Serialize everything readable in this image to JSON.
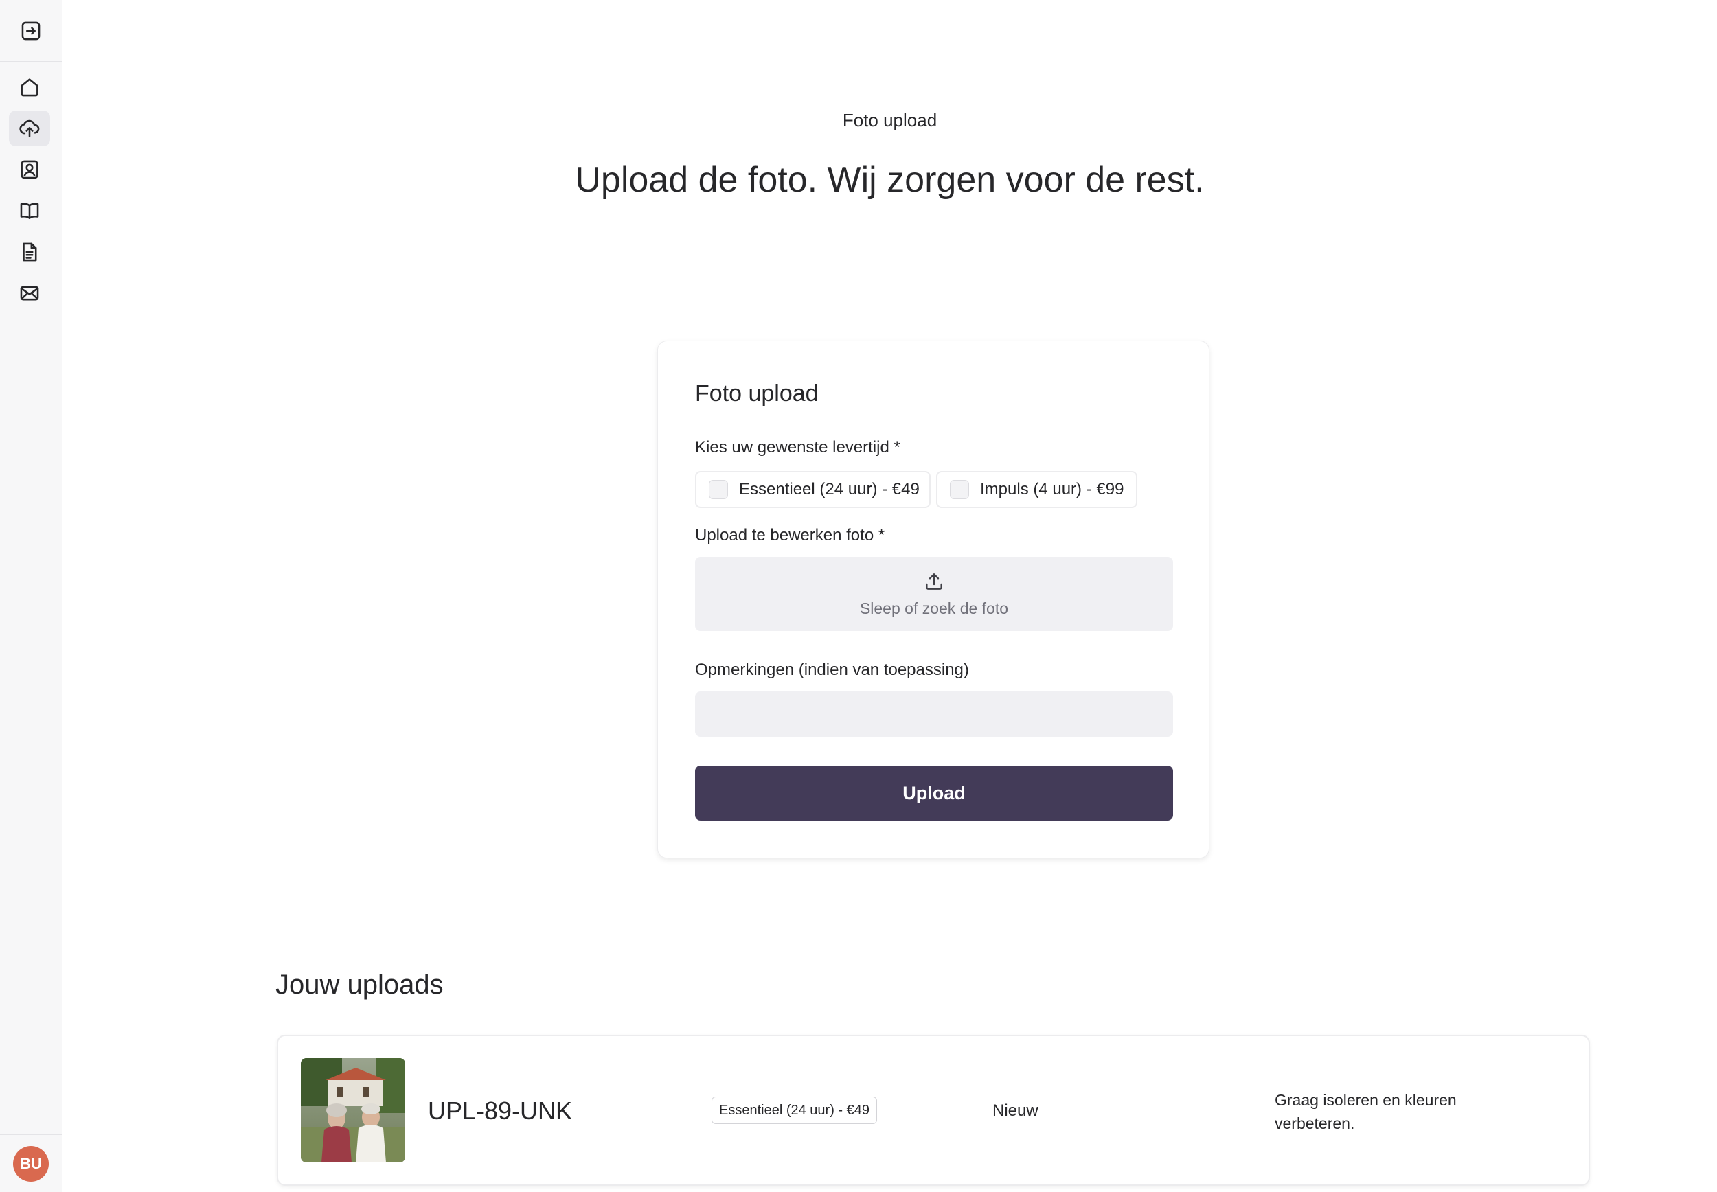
{
  "sidebar": {
    "top_icon": "login-arrow-icon",
    "items": [
      {
        "icon": "home-icon",
        "active": false
      },
      {
        "icon": "cloud-upload-icon",
        "active": true
      },
      {
        "icon": "user-card-icon",
        "active": false
      },
      {
        "icon": "book-icon",
        "active": false
      },
      {
        "icon": "document-icon",
        "active": false
      },
      {
        "icon": "mail-icon",
        "active": false
      }
    ],
    "avatar_initials": "BU",
    "avatar_color": "#d9694f"
  },
  "hero": {
    "eyebrow": "Foto upload",
    "headline": "Upload de foto. Wij zorgen voor de rest."
  },
  "form": {
    "title": "Foto upload",
    "delivery_label": "Kies uw gewenste levertijd *",
    "options": [
      {
        "label": "Essentieel (24 uur) - €49",
        "checked": false
      },
      {
        "label": "Impuls (4 uur) - €99",
        "checked": false
      }
    ],
    "photo_label": "Upload te bewerken foto *",
    "dropzone_text": "Sleep of zoek de foto",
    "remarks_label": "Opmerkingen (indien van toepassing)",
    "remarks_value": "",
    "submit_label": "Upload",
    "accent_color": "#433b58"
  },
  "uploads": {
    "title": "Jouw uploads",
    "rows": [
      {
        "code": "UPL-89-UNK",
        "option": "Essentieel (24 uur) - €49",
        "status": "Nieuw",
        "note": "Graag isoleren en kleuren verbeteren."
      }
    ]
  }
}
